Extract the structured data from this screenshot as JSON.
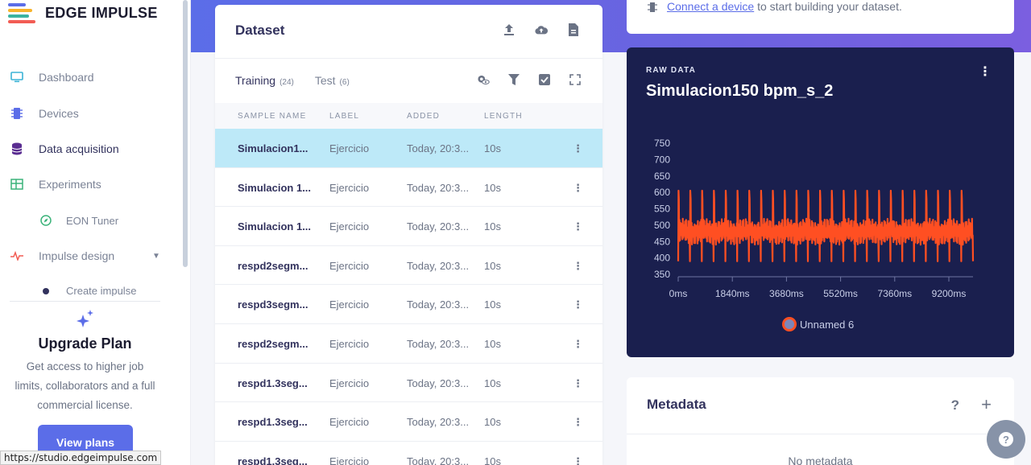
{
  "app": {
    "logo_text": "EDGE IMPULSE"
  },
  "sidebar": {
    "items": [
      {
        "label": "Dashboard",
        "icon": "monitor-icon"
      },
      {
        "label": "Devices",
        "icon": "chip-icon"
      },
      {
        "label": "Data acquisition",
        "icon": "database-icon",
        "active": true
      },
      {
        "label": "Experiments",
        "icon": "table-icon"
      },
      {
        "label": "EON Tuner",
        "icon": "compass-icon"
      },
      {
        "label": "Impulse design",
        "icon": "pulse-icon"
      },
      {
        "label": "Create impulse",
        "icon": "dot-icon"
      }
    ],
    "upgrade": {
      "title": "Upgrade Plan",
      "line1": "Get access to higher job",
      "line2": "limits, collaborators and a full",
      "line3": "commercial license.",
      "button": "View plans"
    },
    "status_url": "https://studio.edgeimpulse.com"
  },
  "dataset": {
    "title": "Dataset",
    "tabs": [
      {
        "label": "Training",
        "count": "(24)"
      },
      {
        "label": "Test",
        "count": "(6)"
      }
    ],
    "columns": [
      "SAMPLE NAME",
      "LABEL",
      "ADDED",
      "LENGTH"
    ],
    "rows": [
      {
        "name": "Simulacion1...",
        "label": "Ejercicio",
        "added": "Today, 20:3...",
        "length": "10s"
      },
      {
        "name": "Simulacion 1...",
        "label": "Ejercicio",
        "added": "Today, 20:3...",
        "length": "10s"
      },
      {
        "name": "Simulacion 1...",
        "label": "Ejercicio",
        "added": "Today, 20:3...",
        "length": "10s"
      },
      {
        "name": "respd2segm...",
        "label": "Ejercicio",
        "added": "Today, 20:3...",
        "length": "10s"
      },
      {
        "name": "respd3segm...",
        "label": "Ejercicio",
        "added": "Today, 20:3...",
        "length": "10s"
      },
      {
        "name": "respd2segm...",
        "label": "Ejercicio",
        "added": "Today, 20:3...",
        "length": "10s"
      },
      {
        "name": "respd1.3seg...",
        "label": "Ejercicio",
        "added": "Today, 20:3...",
        "length": "10s"
      },
      {
        "name": "respd1.3seg...",
        "label": "Ejercicio",
        "added": "Today, 20:3...",
        "length": "10s"
      },
      {
        "name": "respd1.3seg...",
        "label": "Ejercicio",
        "added": "Today, 20:3...",
        "length": "10s"
      }
    ]
  },
  "connect": {
    "link": "Connect a device",
    "rest": " to start building your dataset."
  },
  "raw": {
    "eyebrow": "RAW DATA",
    "title": "Simulacion150 bpm_s_2"
  },
  "metadata": {
    "title": "Metadata",
    "empty": "No metadata"
  },
  "colors": {
    "accent": "#5b6de8",
    "series": "#ff4f22",
    "raw_bg": "#1a1f4e",
    "selected_row": "#bde9f8"
  },
  "chart_data": {
    "type": "line",
    "title": "Simulacion150 bpm_s_2",
    "yticks": [
      750,
      700,
      650,
      600,
      550,
      500,
      450,
      400,
      350
    ],
    "xticks": [
      "0ms",
      "1840ms",
      "3680ms",
      "5520ms",
      "7360ms",
      "9200ms"
    ],
    "ylim": [
      350,
      750
    ],
    "xlim": [
      0,
      10000
    ],
    "grid": false,
    "legend_position": "bottom-center",
    "series": [
      {
        "name": "Unnamed 6",
        "color": "#ff4f22",
        "baseline": 480,
        "peak": 700,
        "trough": 390,
        "beats": 25
      }
    ]
  }
}
